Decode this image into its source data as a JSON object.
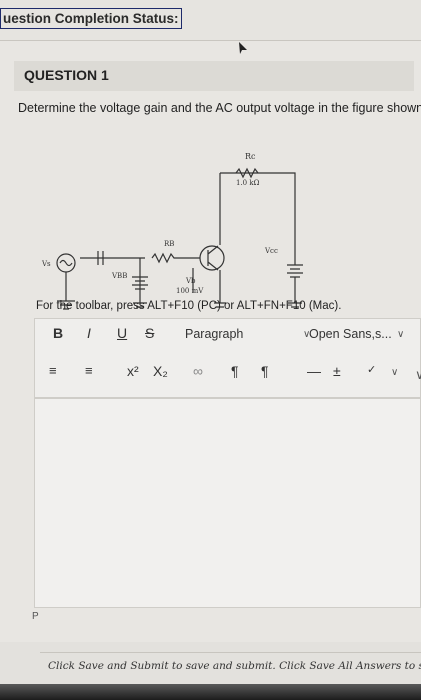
{
  "status": {
    "label": "uestion Completion Status:"
  },
  "question": {
    "title": "QUESTION 1",
    "text": "Determine the voltage gain and the AC output voltage in the figure shown"
  },
  "circuit": {
    "rc_label": "Rc",
    "rc_value": "1.0 kΩ",
    "rb_label": "RB",
    "vs_label": "Vs",
    "vbb_label": "VBB",
    "vb_label": "Vb",
    "vb_value": "100 mV",
    "vcc_label": "Vcc"
  },
  "editor": {
    "toolbar_hint": "For the toolbar, press ALT+F10 (PC) or ALT+FN+F10 (Mac).",
    "bold": "B",
    "italic": "I",
    "underline": "U",
    "strike": "S",
    "paragraph": "Paragraph",
    "font": "Open Sans,s...",
    "superscript": "x²",
    "subscript": "X₂",
    "para_tag": "P"
  },
  "footer": {
    "note": "Click Save and Submit to save and submit. Click Save All Answers to save"
  }
}
